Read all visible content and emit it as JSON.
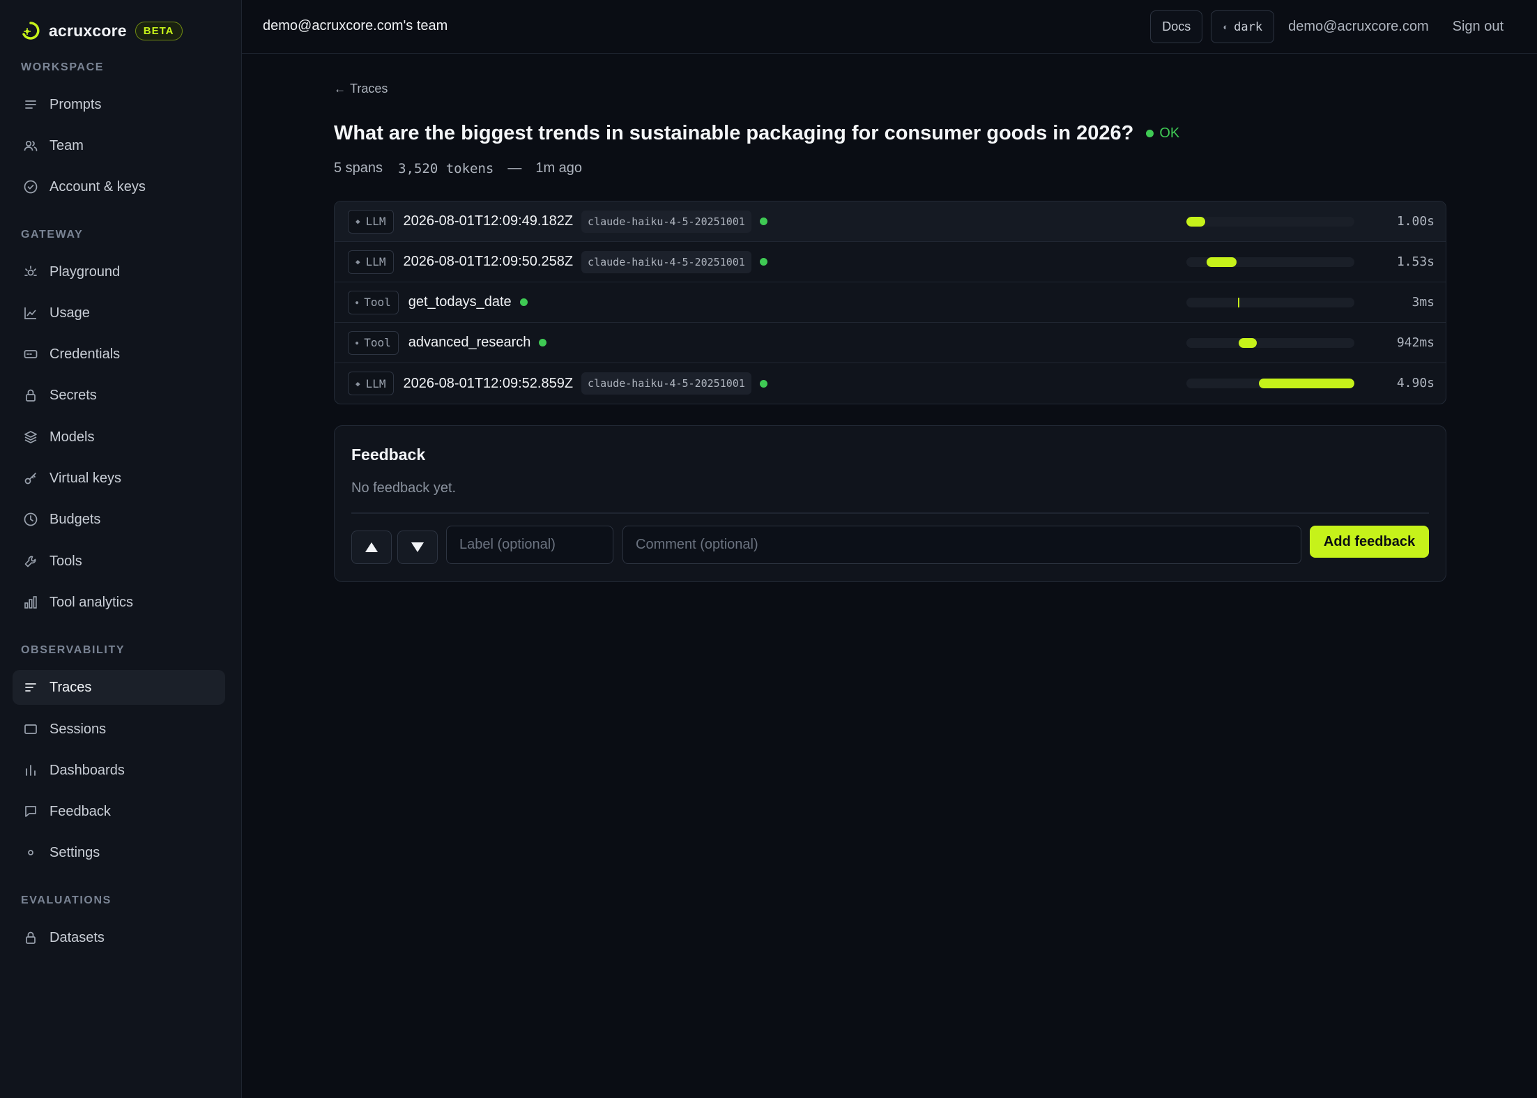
{
  "sidebar": {
    "brand": {
      "name": "acruxcore",
      "badge": "BETA"
    },
    "sections": {
      "workspace": "WORKSPACE",
      "gateway": "GATEWAY",
      "observability": "OBSERVABILITY",
      "evaluations": "EVALUATIONS"
    },
    "items": {
      "prompts": "Prompts",
      "team": "Team",
      "account": "Account & keys",
      "playground": "Playground",
      "usage": "Usage",
      "credentials": "Credentials",
      "secrets": "Secrets",
      "models": "Models",
      "virtual_keys": "Virtual keys",
      "budgets": "Budgets",
      "tools": "Tools",
      "tool_analytics": "Tool analytics",
      "traces": "Traces",
      "sessions": "Sessions",
      "dashboards": "Dashboards",
      "feedback": "Feedback",
      "settings": "Settings",
      "datasets": "Datasets"
    },
    "active": "traces"
  },
  "topbar": {
    "team": "demo@acruxcore.com's team",
    "docs": "Docs",
    "theme": "dark",
    "email": "demo@acruxcore.com",
    "signout": "Sign out"
  },
  "trace": {
    "breadcrumb": "Traces",
    "title": "What are the biggest trends in sustainable packaging for consumer goods in 2026?",
    "status": "OK",
    "spans_count": "5 spans",
    "tokens": "3,520 tokens",
    "separator": "—",
    "age": "1m ago"
  },
  "spans": [
    {
      "kind": "LLM",
      "name": "2026-08-01T12:09:49.182Z",
      "model": "claude-haiku-4-5-20251001",
      "duration": "1.00s",
      "bar_start": 0.0,
      "bar_fraction": 0.11
    },
    {
      "kind": "LLM",
      "name": "2026-08-01T12:09:50.258Z",
      "model": "claude-haiku-4-5-20251001",
      "duration": "1.53s",
      "bar_start": 0.12,
      "bar_fraction": 0.18
    },
    {
      "kind": "Tool",
      "name": "get_todays_date",
      "model": "",
      "duration": "3ms",
      "bar_start": 0.305,
      "bar_fraction": 0.0
    },
    {
      "kind": "Tool",
      "name": "advanced_research",
      "model": "",
      "duration": "942ms",
      "bar_start": 0.31,
      "bar_fraction": 0.11
    },
    {
      "kind": "LLM",
      "name": "2026-08-01T12:09:52.859Z",
      "model": "claude-haiku-4-5-20251001",
      "duration": "4.90s",
      "bar_start": 0.43,
      "bar_fraction": 0.57
    }
  ],
  "feedback": {
    "title": "Feedback",
    "empty": "No feedback yet.",
    "label_placeholder": "Label (optional)",
    "comment_placeholder": "Comment (optional)",
    "submit": "Add feedback"
  },
  "colors": {
    "accent": "#c6f21a",
    "ok": "#3fca54",
    "background": "#0a0d14",
    "sidebar": "#10141c"
  }
}
